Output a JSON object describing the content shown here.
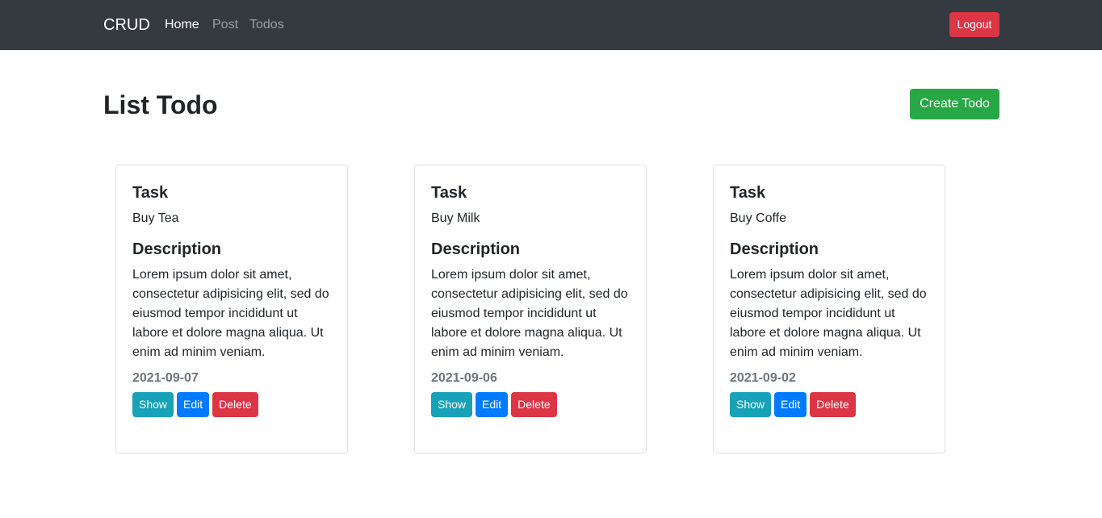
{
  "navbar": {
    "brand": "CRUD",
    "links": [
      {
        "label": "Home",
        "active": true
      },
      {
        "label": "Post",
        "active": false
      },
      {
        "label": "Todos",
        "active": false
      }
    ],
    "logout_label": "Logout"
  },
  "page": {
    "title": "List Todo",
    "create_label": "Create Todo"
  },
  "colors": {
    "navbar_bg": "#343a40",
    "danger": "#dc3545",
    "success": "#28a745",
    "info": "#17a2b8",
    "primary": "#007bff",
    "muted": "#6c757d"
  },
  "cards": [
    {
      "task_heading": "Task",
      "task": "Buy Tea",
      "description_heading": "Description",
      "description": "Lorem ipsum dolor sit amet, consectetur adipisicing elit, sed do eiusmod tempor incididunt ut labore et dolore magna aliqua. Ut enim ad minim veniam.",
      "date": "2021-09-07",
      "show_label": "Show",
      "edit_label": "Edit",
      "delete_label": "Delete"
    },
    {
      "task_heading": "Task",
      "task": "Buy Milk",
      "description_heading": "Description",
      "description": "Lorem ipsum dolor sit amet, consectetur adipisicing elit, sed do eiusmod tempor incididunt ut labore et dolore magna aliqua. Ut enim ad minim veniam.",
      "date": "2021-09-06",
      "show_label": "Show",
      "edit_label": "Edit",
      "delete_label": "Delete"
    },
    {
      "task_heading": "Task",
      "task": "Buy Coffe",
      "description_heading": "Description",
      "description": "Lorem ipsum dolor sit amet, consectetur adipisicing elit, sed do eiusmod tempor incididunt ut labore et dolore magna aliqua. Ut enim ad minim veniam.",
      "date": "2021-09-02",
      "show_label": "Show",
      "edit_label": "Edit",
      "delete_label": "Delete"
    }
  ]
}
